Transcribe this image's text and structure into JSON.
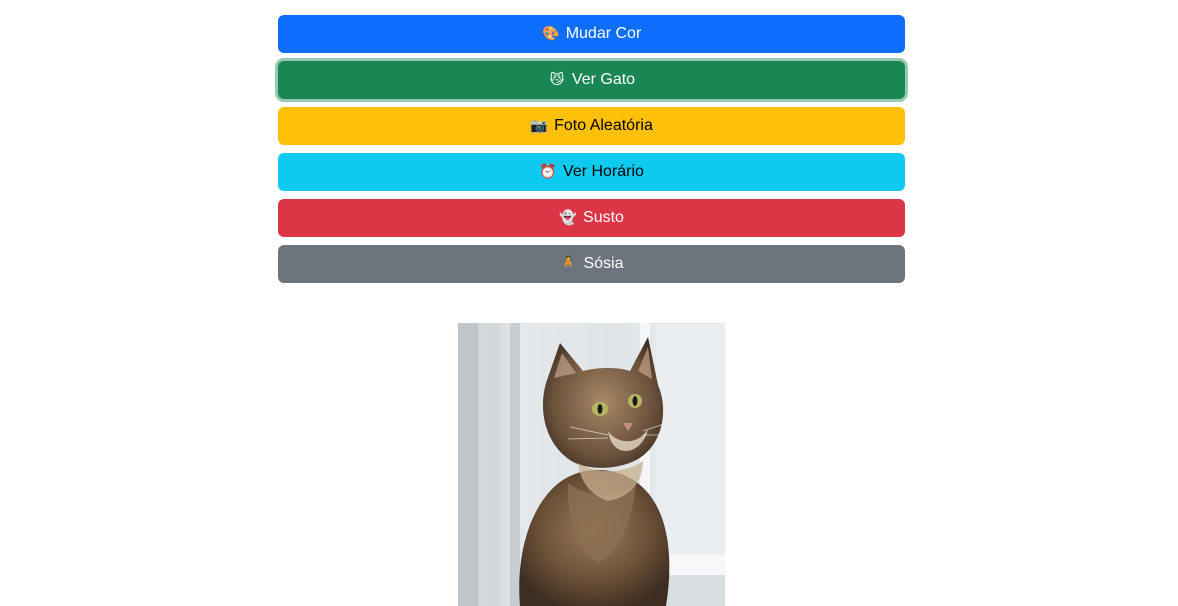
{
  "buttons": [
    {
      "label": "Mudar Cor",
      "emoji": "🎨",
      "icon": "palette-icon",
      "color": "#0d6efd"
    },
    {
      "label": "Ver Gato",
      "emoji": "😼",
      "icon": "cat-face-icon",
      "color": "#198754"
    },
    {
      "label": "Foto Aleatória",
      "emoji": "📷",
      "icon": "camera-icon",
      "color": "#ffc107"
    },
    {
      "label": "Ver Horário",
      "emoji": "⏰",
      "icon": "alarm-clock-icon",
      "color": "#0dcaf0"
    },
    {
      "label": "Susto",
      "emoji": "👻",
      "icon": "ghost-icon",
      "color": "#dc3545"
    },
    {
      "label": "Sósia",
      "emoji": "🧍",
      "icon": "person-standing-icon",
      "color": "#6c757d"
    }
  ],
  "image": {
    "icon": "cat-photo"
  }
}
